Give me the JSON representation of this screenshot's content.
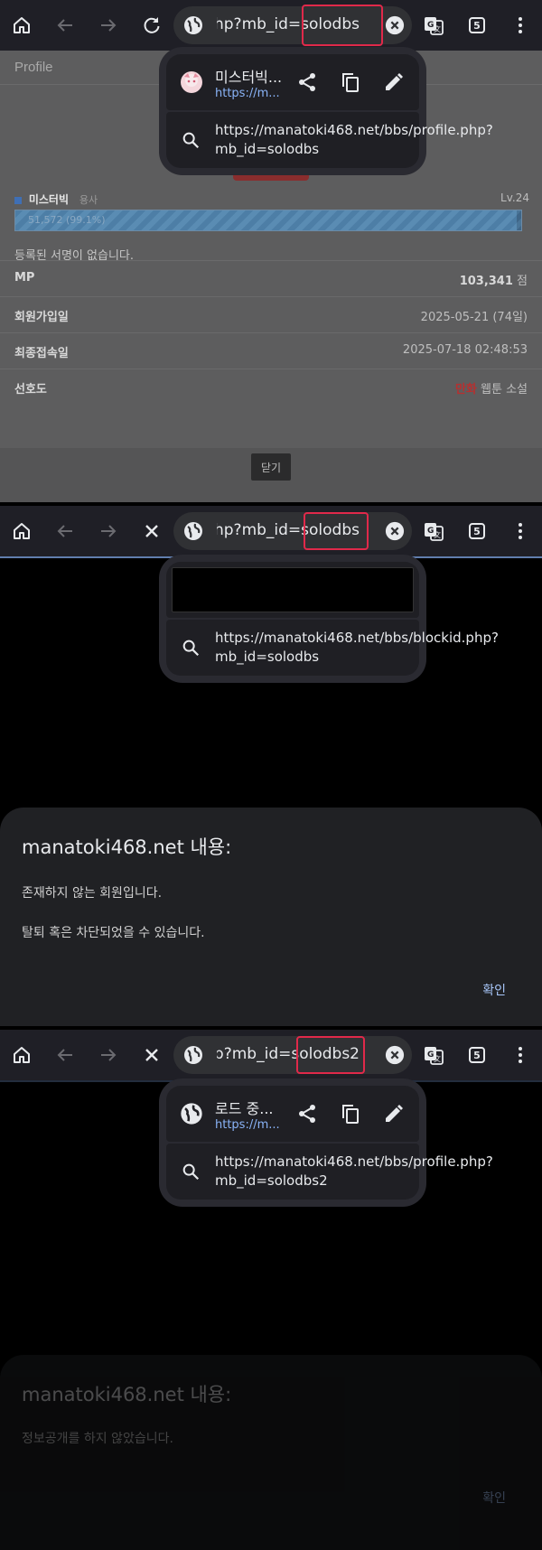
{
  "panels": [
    {
      "toolbar": {
        "url_display": "….php?mb_id=solodbs",
        "reload_state": "reload",
        "tab_count": "5"
      },
      "page": {
        "header": "Profile",
        "nickname": "미스터빅",
        "role": "용사",
        "level": "Lv.24",
        "exp_text": "51,572 (99.1%)",
        "exp_progress": 0.991,
        "signature": "등록된 서명이 없습니다.",
        "rows": [
          {
            "label": "MP",
            "value": "103,341",
            "suffix": " 점"
          },
          {
            "label": "회원가입일",
            "value": "2025-05-21 (74일)"
          },
          {
            "label": "최종접속일",
            "value": "2025-07-18 02:48:53"
          },
          {
            "label": "선호도",
            "value_red": "만화",
            "value": " 웹툰 소설"
          }
        ],
        "close_label": "닫기"
      },
      "popup": {
        "site_title": "미스터빅...",
        "site_url_short": "https://m...",
        "full_url": "https://manatoki468.net/bbs/profile.php?mb_id=solodbs"
      }
    },
    {
      "toolbar": {
        "url_display": "…l.php?mb_id=solodbs",
        "reload_state": "stop",
        "tab_count": "5"
      },
      "popup": {
        "full_url": "https://manatoki468.net/bbs/blockid.php?mb_id=solodbs"
      },
      "dialog": {
        "title": "manatoki468.net 내용:",
        "message_1": "존재하지 않는 회원입니다.",
        "message_2": "탈퇴 혹은 차단되었을 수 있습니다.",
        "ok": "확인"
      }
    },
    {
      "toolbar": {
        "url_display": "…ohp?mb_id=solodbs2",
        "reload_state": "stop",
        "tab_count": "5"
      },
      "popup": {
        "site_title": "로드 중...",
        "site_url_short": "https://m...",
        "full_url": "https://manatoki468.net/bbs/profile.php?mb_id=solodbs2"
      },
      "dialog": {
        "title": "manatoki468.net 내용:",
        "message_1": "정보공개를 하지 않았습니다.",
        "ok": "확인"
      }
    }
  ],
  "colors": {
    "toolbar_bg": "#1f1f26",
    "highlight": "#e0294a",
    "link_blue": "#8ab4f8",
    "accent_red": "#b63030"
  },
  "icons": [
    "home-icon",
    "back-arrow-icon",
    "forward-arrow-icon",
    "reload-icon",
    "stop-icon",
    "globe-icon",
    "clear-icon",
    "translate-icon",
    "tab-switcher-icon",
    "more-menu-icon",
    "share-icon",
    "copy-icon",
    "edit-icon",
    "search-icon"
  ]
}
